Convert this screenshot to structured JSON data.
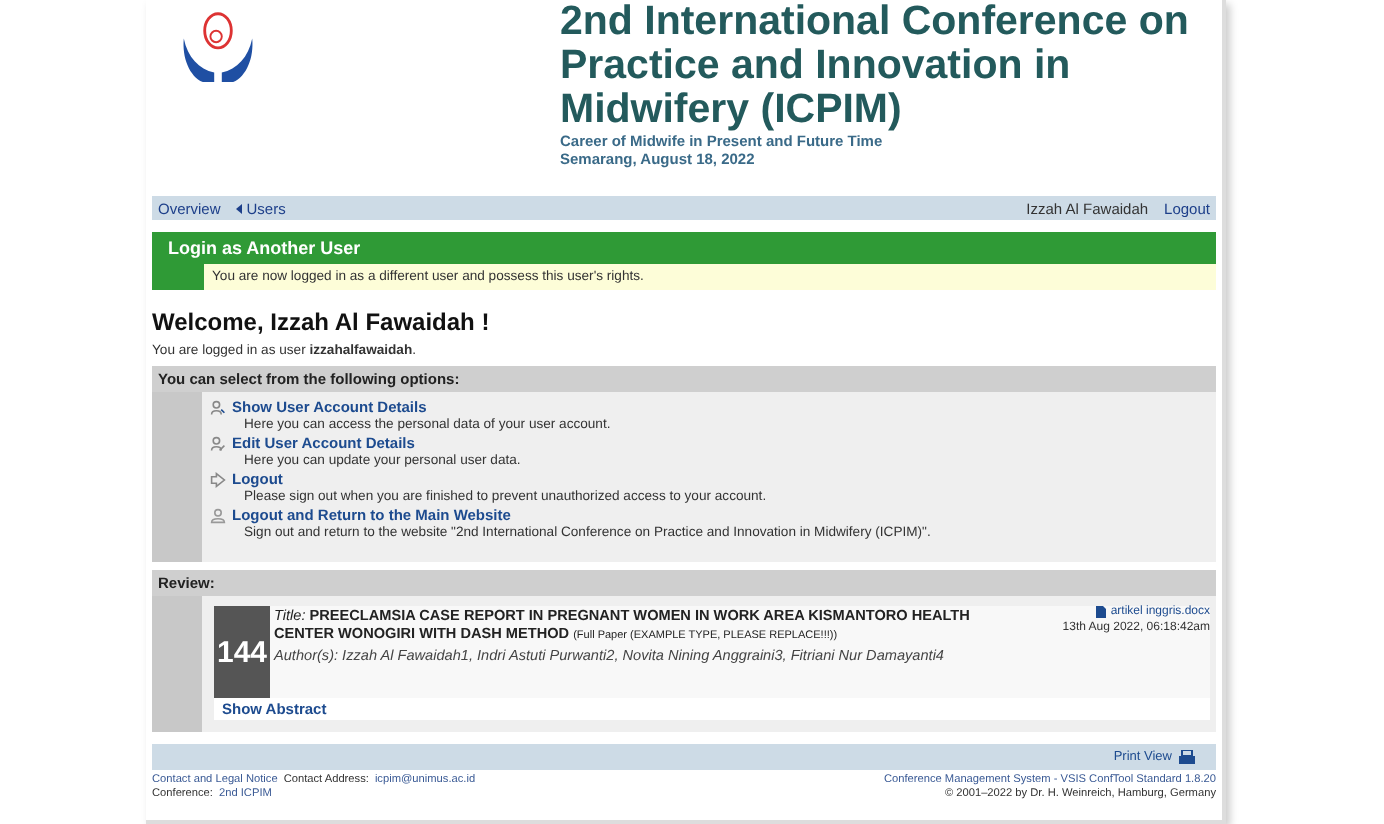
{
  "header": {
    "title_lines": [
      "2nd International Conference on",
      "Practice and Innovation in",
      "Midwifery (ICPIM)"
    ],
    "subtitle": "Career of Midwife in Present and Future Time",
    "place_date": "Semarang, August 18, 2022"
  },
  "nav": {
    "items": [
      {
        "label": "Overview",
        "kind": "plain"
      },
      {
        "label": "Users",
        "kind": "arrow"
      }
    ],
    "user": "Izzah Al Fawaidah",
    "logout": "Logout"
  },
  "notice": {
    "title": "Login as Another User",
    "message": "You are now logged in as a different user and possess this user's rights."
  },
  "welcome": "Welcome, Izzah Al Fawaidah !",
  "logged_in": "You are logged in as user **izzahalfawaidah**.",
  "options": {
    "heading": "You can select from the following options:",
    "items": [
      {
        "kind": "user",
        "label": "Show User Account Details",
        "description": "Here you can access the personal data of your user account."
      },
      {
        "kind": "edit",
        "label": "Edit User Account Details",
        "description": "Here you can update your personal user data."
      },
      {
        "kind": "logout",
        "label": "Logout",
        "description": "Please sign out when you are finished to prevent unauthorized access to your account."
      },
      {
        "kind": "home",
        "label": "Logout and Return to the Main Website",
        "description": "Sign out and return to the website \"2nd International Conference on Practice and Innovation in Midwifery (ICPIM)\"."
      }
    ]
  },
  "review": {
    "heading": "Review:",
    "number": "144",
    "title_label": "Title:",
    "title": "PREECLAMSIA CASE REPORT IN PREGNANT WOMEN IN WORK AREA KISMANTORO HEALTH CENTER WONOGIRI WITH DASH METHOD",
    "type": "(Full Paper (EXAMPLE TYPE, PLEASE REPLACE!!!))",
    "authors": "Author(s): Izzah Al Fawaidah1, Indri Astuti Purwanti2, Novita Nining Anggraini3, Fitriani Nur Damayanti4",
    "file": "artikel inggris.docx",
    "date": "13th Aug 2022, 06:18:42am",
    "show_abstract": "Show Abstract"
  },
  "print_view": "Print View",
  "footer": {
    "contact_link": "Contact and Legal Notice",
    "contact_label": "Contact Address:",
    "email": "icpim@unimus.ac.id",
    "conference_label": "Conference:",
    "conference": "2nd ICPIM",
    "system": "Conference Management System - VSIS ConfTool Standard 1.8.20",
    "copyright": "© 2001–2022 by Dr. H. Weinreich, Hamburg, Germany"
  }
}
